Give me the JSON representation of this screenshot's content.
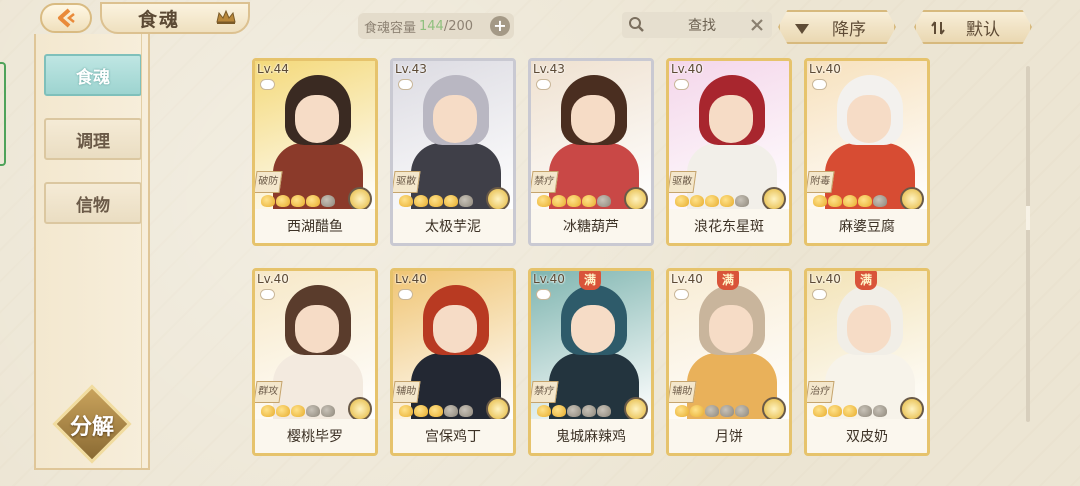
{
  "header": {
    "title": "食魂",
    "capacity_label": "食魂容量",
    "capacity_current": "144",
    "capacity_max": "/200",
    "capacity_plus": "+",
    "search_text": "查找",
    "sort_order": "降序",
    "sort_default": "默认"
  },
  "sidebar": {
    "tabs": [
      {
        "label": "食魂",
        "active": true
      },
      {
        "label": "调理",
        "active": false
      },
      {
        "label": "信物",
        "active": false
      }
    ],
    "decompose_label": "分解"
  },
  "colors": {
    "accent_teal": "#9dd4d0",
    "card_gold": "#e6c36c",
    "card_silver": "#c9c9d2",
    "full_badge": "#d9543a"
  },
  "cards": [
    {
      "level": "Lv.44",
      "name": "西湖醋鱼",
      "role": "破防",
      "stars_on": 4,
      "full": false,
      "frame": "gold",
      "hair": "#3a2a22",
      "body": "#8b3a2a",
      "bg": "#f4d97a"
    },
    {
      "level": "Lv.43",
      "name": "太极芋泥",
      "role": "驱散",
      "stars_on": 4,
      "full": false,
      "frame": "silver",
      "hair": "#b9b7c2",
      "body": "#3f3f48",
      "bg": "#dcdbe2"
    },
    {
      "level": "Lv.43",
      "name": "冰糖葫芦",
      "role": "禁疗",
      "stars_on": 4,
      "full": false,
      "frame": "silver",
      "hair": "#4a2e20",
      "body": "#c94846",
      "bg": "#efe1d0"
    },
    {
      "level": "Lv.40",
      "name": "浪花东星斑",
      "role": "驱散",
      "stars_on": 4,
      "full": false,
      "frame": "gold",
      "hair": "#a8262e",
      "body": "#f2efe9",
      "bg": "#f4d6ea"
    },
    {
      "level": "Lv.40",
      "name": "麻婆豆腐",
      "role": "附毒",
      "stars_on": 4,
      "full": false,
      "frame": "gold",
      "hair": "#f3f1ee",
      "body": "#d74c33",
      "bg": "#f7e1bd"
    },
    {
      "level": "Lv.40",
      "name": "樱桃毕罗",
      "role": "群攻",
      "stars_on": 3,
      "full": false,
      "frame": "gold",
      "hair": "#5a3c2c",
      "body": "#f3eadf",
      "bg": "#f7e8c7"
    },
    {
      "level": "Lv.40",
      "name": "宫保鸡丁",
      "role": "辅助",
      "stars_on": 3,
      "full": false,
      "frame": "gold",
      "hair": "#b83a22",
      "body": "#232833",
      "bg": "#f0c574"
    },
    {
      "level": "Lv.40",
      "name": "鬼城麻辣鸡",
      "role": "禁疗",
      "stars_on": 2,
      "full": true,
      "frame": "gold",
      "hair": "#2e5b6a",
      "body": "#23343e",
      "bg": "#7fb5b0"
    },
    {
      "level": "Lv.40",
      "name": "月饼",
      "role": "辅助",
      "stars_on": 2,
      "full": true,
      "frame": "gold",
      "hair": "#c9b59c",
      "body": "#e9b15a",
      "bg": "#f8ecd4"
    },
    {
      "level": "Lv.40",
      "name": "双皮奶",
      "role": "治疗",
      "stars_on": 3,
      "full": true,
      "frame": "gold",
      "hair": "#f1eee7",
      "body": "#f7f3ea",
      "bg": "#f3e3b7"
    }
  ],
  "full_badge_text": "满"
}
